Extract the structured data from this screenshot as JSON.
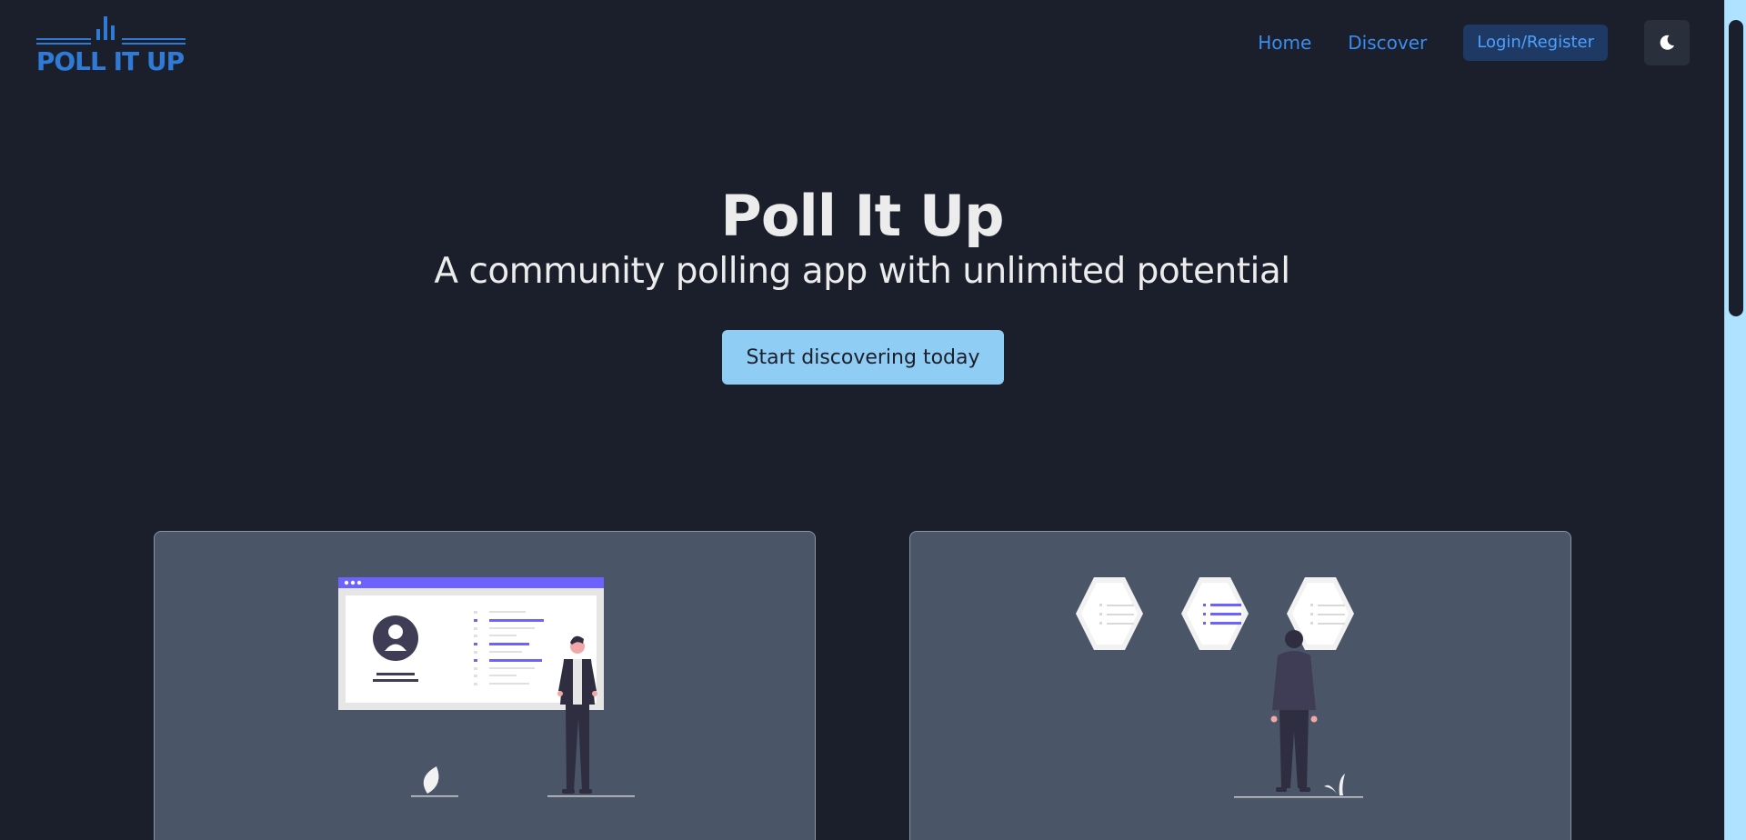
{
  "nav": {
    "logo_text": "POLL IT UP",
    "home": "Home",
    "discover": "Discover",
    "login": "Login/Register",
    "theme_icon": "moon-icon"
  },
  "hero": {
    "title": "Poll It Up",
    "subtitle": "A community polling app with unlimited potential",
    "cta": "Start discovering today"
  },
  "colors": {
    "background": "#1b1f2b",
    "accent": "#3b8df0",
    "cta": "#90cdf4",
    "card": "#4a5568",
    "illustration_accent": "#6c63ff"
  }
}
